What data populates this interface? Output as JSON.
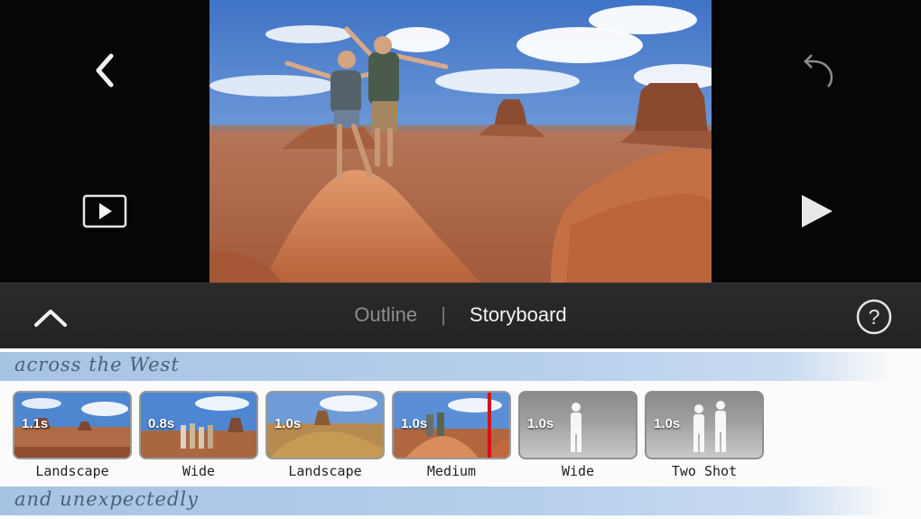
{
  "toolbar": {
    "tabs": [
      {
        "label": "Outline",
        "selected": false
      },
      {
        "label": "Storyboard",
        "selected": true
      }
    ],
    "separator": "|",
    "help_label": "?"
  },
  "icons": {
    "back": "chevron-left-icon",
    "play_clip": "play-clip-icon",
    "undo": "undo-icon",
    "play": "play-icon",
    "collapse": "chevron-up-icon",
    "help": "help-icon"
  },
  "colors": {
    "viewer_bg": "#060606",
    "toolbar_bg": "#2b2b2b",
    "section_band": "#b6cfec",
    "playhead": "#d6101b"
  },
  "storyboard": {
    "sections": [
      {
        "title": "across the West"
      },
      {
        "title": "and unexpectedly"
      }
    ],
    "clips": [
      {
        "duration": "1.1s",
        "label": "Landscape",
        "kind": "landscape"
      },
      {
        "duration": "0.8s",
        "label": "Wide",
        "kind": "group"
      },
      {
        "duration": "1.0s",
        "label": "Landscape",
        "kind": "rock"
      },
      {
        "duration": "1.0s",
        "label": "Medium",
        "kind": "medium"
      },
      {
        "duration": "1.0s",
        "label": "Wide",
        "kind": "placeholder-one"
      },
      {
        "duration": "1.0s",
        "label": "Two Shot",
        "kind": "placeholder-two"
      }
    ]
  }
}
